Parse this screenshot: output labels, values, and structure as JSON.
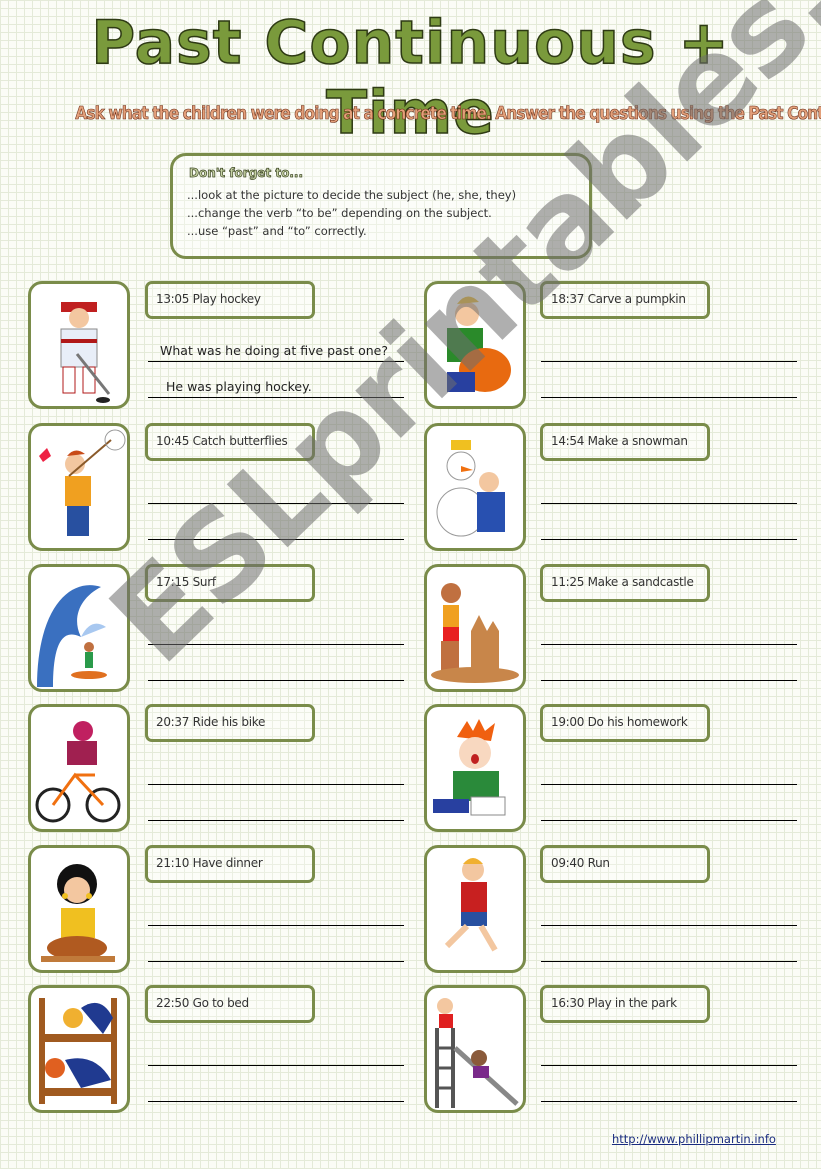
{
  "header": {
    "title": "Past Continuous + Time",
    "instructions": "Ask what the children were doing at a concrete time. Answer the questions using the Past Continuous."
  },
  "tips": {
    "heading": "Don't forget to...",
    "lines": [
      "...look at the picture to decide the subject (he, she, they)",
      "...change the verb “to be” depending on the subject.",
      "...use “past” and “to” correctly."
    ]
  },
  "exercises": [
    {
      "label": "13:05 Play hockey",
      "picture": "hockey-player-icon",
      "question": "What was he doing at five past one?",
      "answer": "He was playing hockey."
    },
    {
      "label": "18:37 Carve a pumpkin",
      "picture": "pumpkin-carving-icon",
      "question": "",
      "answer": ""
    },
    {
      "label": "10:45 Catch butterflies",
      "picture": "butterfly-net-icon",
      "question": "",
      "answer": ""
    },
    {
      "label": "14:54 Make a snowman",
      "picture": "snowman-icon",
      "question": "",
      "answer": ""
    },
    {
      "label": "17:15 Surf",
      "picture": "surfing-wave-icon",
      "question": "",
      "answer": ""
    },
    {
      "label": "11:25 Make a sandcastle",
      "picture": "sandcastle-icon",
      "question": "",
      "answer": ""
    },
    {
      "label": "20:37 Ride his bike",
      "picture": "bicycle-icon",
      "question": "",
      "answer": ""
    },
    {
      "label": "19:00 Do his homework",
      "picture": "homework-icon",
      "question": "",
      "answer": ""
    },
    {
      "label": "21:10 Have dinner",
      "picture": "dinner-turkey-icon",
      "question": "",
      "answer": ""
    },
    {
      "label": "09:40 Run",
      "picture": "running-boy-icon",
      "question": "",
      "answer": ""
    },
    {
      "label": "22:50 Go to bed",
      "picture": "bunk-bed-icon",
      "question": "",
      "answer": ""
    },
    {
      "label": "16:30 Play in the park",
      "picture": "playground-slide-icon",
      "question": "",
      "answer": ""
    }
  ],
  "watermark": "ESLprintables.com",
  "footer": {
    "credit_link": "http://www.phillipmartin.info"
  },
  "colors": {
    "frame_green": "#7a8c4a",
    "title_green": "#7a9a3c",
    "subtitle_orange": "#e3a07a",
    "link_blue": "#1a2c80"
  }
}
